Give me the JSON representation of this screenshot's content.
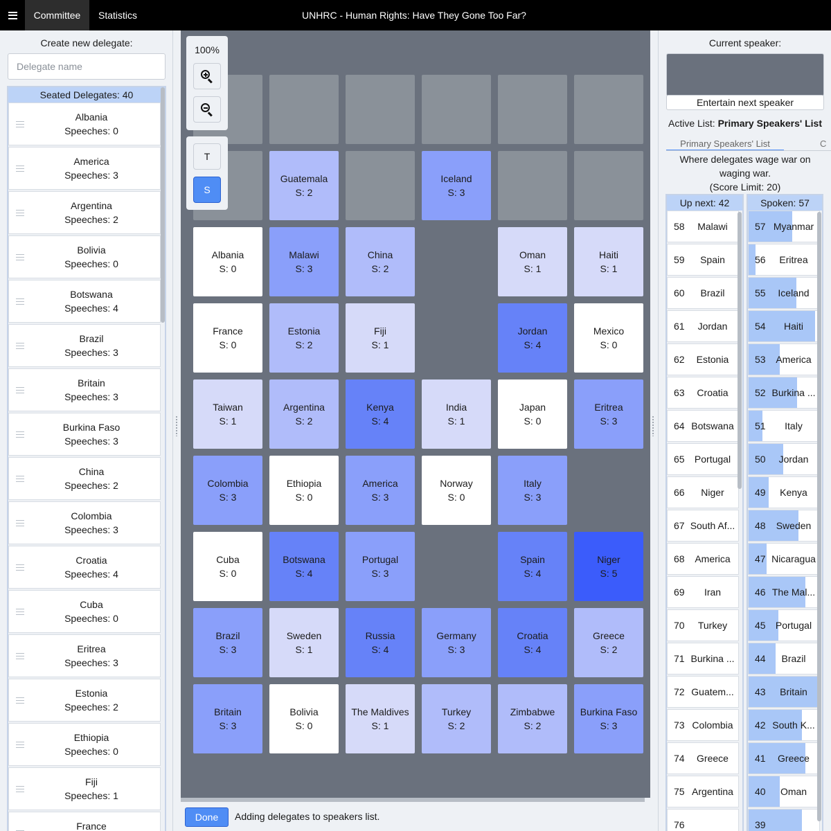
{
  "topbar": {
    "menu_icon": "hamburger-menu-icon",
    "tabs": [
      "Committee",
      "Statistics"
    ],
    "title": "UNHRC - Human Rights: Have They Gone Too Far?"
  },
  "left": {
    "create_label": "Create new delegate:",
    "delegate_placeholder": "Delegate name",
    "seated_header": "Seated Delegates: 40",
    "delegates": [
      {
        "name": "Albania",
        "speeches": "Speeches: 0"
      },
      {
        "name": "America",
        "speeches": "Speeches: 3"
      },
      {
        "name": "Argentina",
        "speeches": "Speeches: 2"
      },
      {
        "name": "Bolivia",
        "speeches": "Speeches: 0"
      },
      {
        "name": "Botswana",
        "speeches": "Speeches: 4"
      },
      {
        "name": "Brazil",
        "speeches": "Speeches: 3"
      },
      {
        "name": "Britain",
        "speeches": "Speeches: 3"
      },
      {
        "name": "Burkina Faso",
        "speeches": "Speeches: 3"
      },
      {
        "name": "China",
        "speeches": "Speeches: 2"
      },
      {
        "name": "Colombia",
        "speeches": "Speeches: 3"
      },
      {
        "name": "Croatia",
        "speeches": "Speeches: 4"
      },
      {
        "name": "Cuba",
        "speeches": "Speeches: 0"
      },
      {
        "name": "Eritrea",
        "speeches": "Speeches: 3"
      },
      {
        "name": "Estonia",
        "speeches": "Speeches: 2"
      },
      {
        "name": "Ethiopia",
        "speeches": "Speeches: 0"
      },
      {
        "name": "Fiji",
        "speeches": "Speeches: 1"
      },
      {
        "name": "France",
        "speeches": ""
      }
    ]
  },
  "toolbar": {
    "zoom_level": "100%",
    "zoom_in_icon": "zoom-in-icon",
    "zoom_out_icon": "zoom-out-icon",
    "mode_t": "T",
    "mode_s": "S"
  },
  "seating": {
    "empty_color": "#8a9199",
    "score_colors": {
      "0": "#ffffff",
      "1": "#d6daf9",
      "2": "#b0bcfa",
      "3": "#8a9ffa",
      "4": "#6682f8",
      "5": "#3b5cfb"
    },
    "grid": [
      [
        null,
        null,
        null,
        null,
        null,
        null
      ],
      [
        null,
        {
          "name": "Guatemala",
          "score": "S: 2",
          "s": 2
        },
        null,
        {
          "name": "Iceland",
          "score": "S: 3",
          "s": 3
        },
        null,
        null
      ],
      [
        {
          "name": "Albania",
          "score": "S: 0",
          "s": 0
        },
        {
          "name": "Malawi",
          "score": "S: 3",
          "s": 3
        },
        {
          "name": "China",
          "score": "S: 2",
          "s": 2
        },
        "gap",
        {
          "name": "Oman",
          "score": "S: 1",
          "s": 1
        },
        {
          "name": "Haiti",
          "score": "S: 1",
          "s": 1
        }
      ],
      [
        {
          "name": "France",
          "score": "S: 0",
          "s": 0
        },
        {
          "name": "Estonia",
          "score": "S: 2",
          "s": 2
        },
        {
          "name": "Fiji",
          "score": "S: 1",
          "s": 1
        },
        "gap",
        {
          "name": "Jordan",
          "score": "S: 4",
          "s": 4
        },
        {
          "name": "Mexico",
          "score": "S: 0",
          "s": 0
        }
      ],
      [
        {
          "name": "Taiwan",
          "score": "S: 1",
          "s": 1
        },
        {
          "name": "Argentina",
          "score": "S: 2",
          "s": 2
        },
        {
          "name": "Kenya",
          "score": "S: 4",
          "s": 4
        },
        {
          "name": "India",
          "score": "S: 1",
          "s": 1
        },
        {
          "name": "Japan",
          "score": "S: 0",
          "s": 0
        },
        {
          "name": "Eritrea",
          "score": "S: 3",
          "s": 3
        }
      ],
      [
        {
          "name": "Colombia",
          "score": "S: 3",
          "s": 3
        },
        {
          "name": "Ethiopia",
          "score": "S: 0",
          "s": 0
        },
        {
          "name": "America",
          "score": "S: 3",
          "s": 3
        },
        {
          "name": "Norway",
          "score": "S: 0",
          "s": 0
        },
        {
          "name": "Italy",
          "score": "S: 3",
          "s": 3
        },
        "gap"
      ],
      [
        {
          "name": "Cuba",
          "score": "S: 0",
          "s": 0
        },
        {
          "name": "Botswana",
          "score": "S: 4",
          "s": 4
        },
        {
          "name": "Portugal",
          "score": "S: 3",
          "s": 3
        },
        "gap",
        {
          "name": "Spain",
          "score": "S: 4",
          "s": 4
        },
        {
          "name": "Niger",
          "score": "S: 5",
          "s": 5
        }
      ],
      [
        {
          "name": "Brazil",
          "score": "S: 3",
          "s": 3
        },
        {
          "name": "Sweden",
          "score": "S: 1",
          "s": 1
        },
        {
          "name": "Russia",
          "score": "S: 4",
          "s": 4
        },
        {
          "name": "Germany",
          "score": "S: 3",
          "s": 3
        },
        {
          "name": "Croatia",
          "score": "S: 4",
          "s": 4
        },
        {
          "name": "Greece",
          "score": "S: 2",
          "s": 2
        }
      ],
      [
        {
          "name": "Britain",
          "score": "S: 3",
          "s": 3
        },
        {
          "name": "Bolivia",
          "score": "S: 0",
          "s": 0
        },
        {
          "name": "The Maldives",
          "score": "S: 1",
          "s": 1
        },
        {
          "name": "Turkey",
          "score": "S: 2",
          "s": 2
        },
        {
          "name": "Zimbabwe",
          "score": "S: 2",
          "s": 2
        },
        {
          "name": "Burkina Faso",
          "score": "S: 3",
          "s": 3
        }
      ]
    ]
  },
  "status": {
    "done_label": "Done",
    "message": "Adding delegates to speakers list."
  },
  "right": {
    "current_speaker_label": "Current speaker:",
    "entertain_label": "Entertain next speaker",
    "active_list_prefix": "Active List:",
    "active_list_name": "Primary Speakers' List",
    "tabs": [
      "Primary Speakers' List",
      "C"
    ],
    "topic": "Where delegates wage war on waging war.",
    "score_limit": "(Score Limit: 20)",
    "up_next_header": "Up next: 42",
    "spoken_header": "Spoken: 57",
    "up_next": [
      {
        "num": "58",
        "name": "Malawi"
      },
      {
        "num": "59",
        "name": "Spain"
      },
      {
        "num": "60",
        "name": "Brazil"
      },
      {
        "num": "61",
        "name": "Jordan"
      },
      {
        "num": "62",
        "name": "Estonia"
      },
      {
        "num": "63",
        "name": "Croatia"
      },
      {
        "num": "64",
        "name": "Botswana"
      },
      {
        "num": "65",
        "name": "Portugal"
      },
      {
        "num": "66",
        "name": "Niger"
      },
      {
        "num": "67",
        "name": "South Af..."
      },
      {
        "num": "68",
        "name": "America"
      },
      {
        "num": "69",
        "name": "Iran"
      },
      {
        "num": "70",
        "name": "Turkey"
      },
      {
        "num": "71",
        "name": "Burkina ..."
      },
      {
        "num": "72",
        "name": "Guatem..."
      },
      {
        "num": "73",
        "name": "Colombia"
      },
      {
        "num": "74",
        "name": "Greece"
      },
      {
        "num": "75",
        "name": "Argentina"
      },
      {
        "num": "76",
        "name": ""
      }
    ],
    "spoken": [
      {
        "num": "57",
        "name": "Myanmar",
        "progress": 0.62
      },
      {
        "num": "56",
        "name": "Eritrea",
        "progress": 0.1
      },
      {
        "num": "55",
        "name": "Iceland",
        "progress": 0.68
      },
      {
        "num": "54",
        "name": "Haiti",
        "progress": 0.94
      },
      {
        "num": "53",
        "name": "America",
        "progress": 0.44
      },
      {
        "num": "52",
        "name": "Burkina ...",
        "progress": 0.69
      },
      {
        "num": "51",
        "name": "Italy",
        "progress": 0.2
      },
      {
        "num": "50",
        "name": "Jordan",
        "progress": 0.49
      },
      {
        "num": "49",
        "name": "Kenya",
        "progress": 0.28
      },
      {
        "num": "48",
        "name": "Sweden",
        "progress": 0.71
      },
      {
        "num": "47",
        "name": "Nicaragua",
        "progress": 0.25
      },
      {
        "num": "46",
        "name": "The Mal...",
        "progress": 0.8
      },
      {
        "num": "45",
        "name": "Portugal",
        "progress": 0.42
      },
      {
        "num": "44",
        "name": "Brazil",
        "progress": 0.38
      },
      {
        "num": "43",
        "name": "Britain",
        "progress": 1.0
      },
      {
        "num": "42",
        "name": "South K...",
        "progress": 0.75
      },
      {
        "num": "41",
        "name": "Greece",
        "progress": 0.8
      },
      {
        "num": "40",
        "name": "Oman",
        "progress": 0.44
      },
      {
        "num": "39",
        "name": "",
        "progress": 0.75
      }
    ]
  }
}
